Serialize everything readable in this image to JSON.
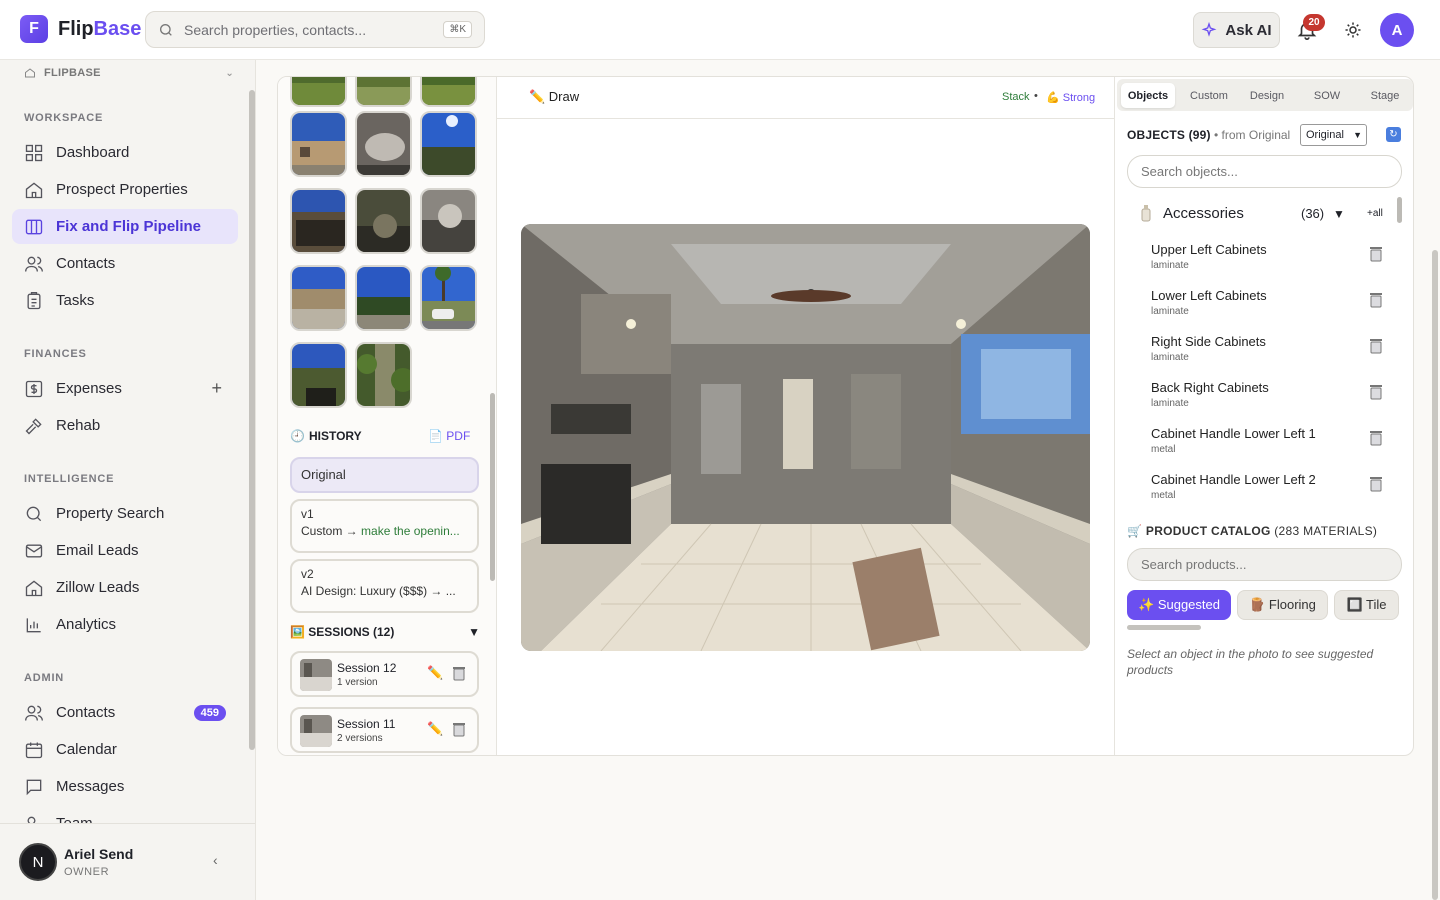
{
  "brand": {
    "part1": "Flip",
    "part2": "Base",
    "mark": "F"
  },
  "search": {
    "placeholder": "Search properties, contacts...",
    "shortcut": "⌘K"
  },
  "header": {
    "ask_ai": "Ask AI",
    "notification_count": "20",
    "avatar_initial": "A"
  },
  "sidebar": {
    "workspace_switch": "FLIPBASE",
    "sections": {
      "workspace": "WORKSPACE",
      "finances": "FINANCES",
      "intelligence": "INTELLIGENCE",
      "admin": "ADMIN"
    },
    "items": {
      "dashboard": "Dashboard",
      "prospect": "Prospect Properties",
      "pipeline": "Fix and Flip Pipeline",
      "contacts": "Contacts",
      "tasks": "Tasks",
      "expenses": "Expenses",
      "rehab": "Rehab",
      "property_search": "Property Search",
      "email_leads": "Email Leads",
      "zillow_leads": "Zillow Leads",
      "analytics": "Analytics",
      "admin_contacts": "Contacts",
      "admin_contacts_badge": "459",
      "calendar": "Calendar",
      "messages": "Messages",
      "team": "Team"
    },
    "user": {
      "initial": "N",
      "name": "Ariel Send",
      "role": "OWNER"
    }
  },
  "history": {
    "title": "HISTORY",
    "pdf": "PDF",
    "entries": [
      {
        "label": "Original"
      },
      {
        "version": "v1",
        "kind": "Custom →",
        "detail": "make the openin..."
      },
      {
        "version": "v2",
        "detail": "AI Design: Luxury ($$$) → ..."
      }
    ]
  },
  "sessions": {
    "title": "SESSIONS (12)",
    "toggle": "▼",
    "items": [
      {
        "name": "Session 12",
        "versions": "1 version"
      },
      {
        "name": "Session 11",
        "versions": "2 versions"
      }
    ]
  },
  "canvas": {
    "draw_label": "✏️ Draw",
    "stack": "Stack",
    "sep": "•",
    "strength": "💪 Strong"
  },
  "panel": {
    "tabs": [
      "Objects",
      "Custom",
      "Design",
      "SOW",
      "Stage"
    ],
    "objects_heading": "OBJECTS (99)",
    "from_label": "• from Original",
    "source_select": "Original",
    "search_objects_placeholder": "Search objects...",
    "group": {
      "name": "Accessories",
      "count": "(36)",
      "toggle": "▼",
      "add_all": "+all"
    },
    "objects": [
      {
        "name": "Upper Left Cabinets",
        "material": "laminate"
      },
      {
        "name": "Lower Left Cabinets",
        "material": "laminate"
      },
      {
        "name": "Right Side Cabinets",
        "material": "laminate"
      },
      {
        "name": "Back Right Cabinets",
        "material": "laminate"
      },
      {
        "name": "Cabinet Handle Lower Left 1",
        "material": "metal"
      },
      {
        "name": "Cabinet Handle Lower Left 2",
        "material": "metal"
      }
    ],
    "catalog_heading": "PRODUCT CATALOG",
    "catalog_count": "(283 MATERIALS)",
    "search_products_placeholder": "Search products...",
    "chips": [
      "✨ Suggested",
      "🪵 Flooring",
      "🔲 Tile"
    ],
    "hint": "Select an object in the photo to see suggested products"
  }
}
